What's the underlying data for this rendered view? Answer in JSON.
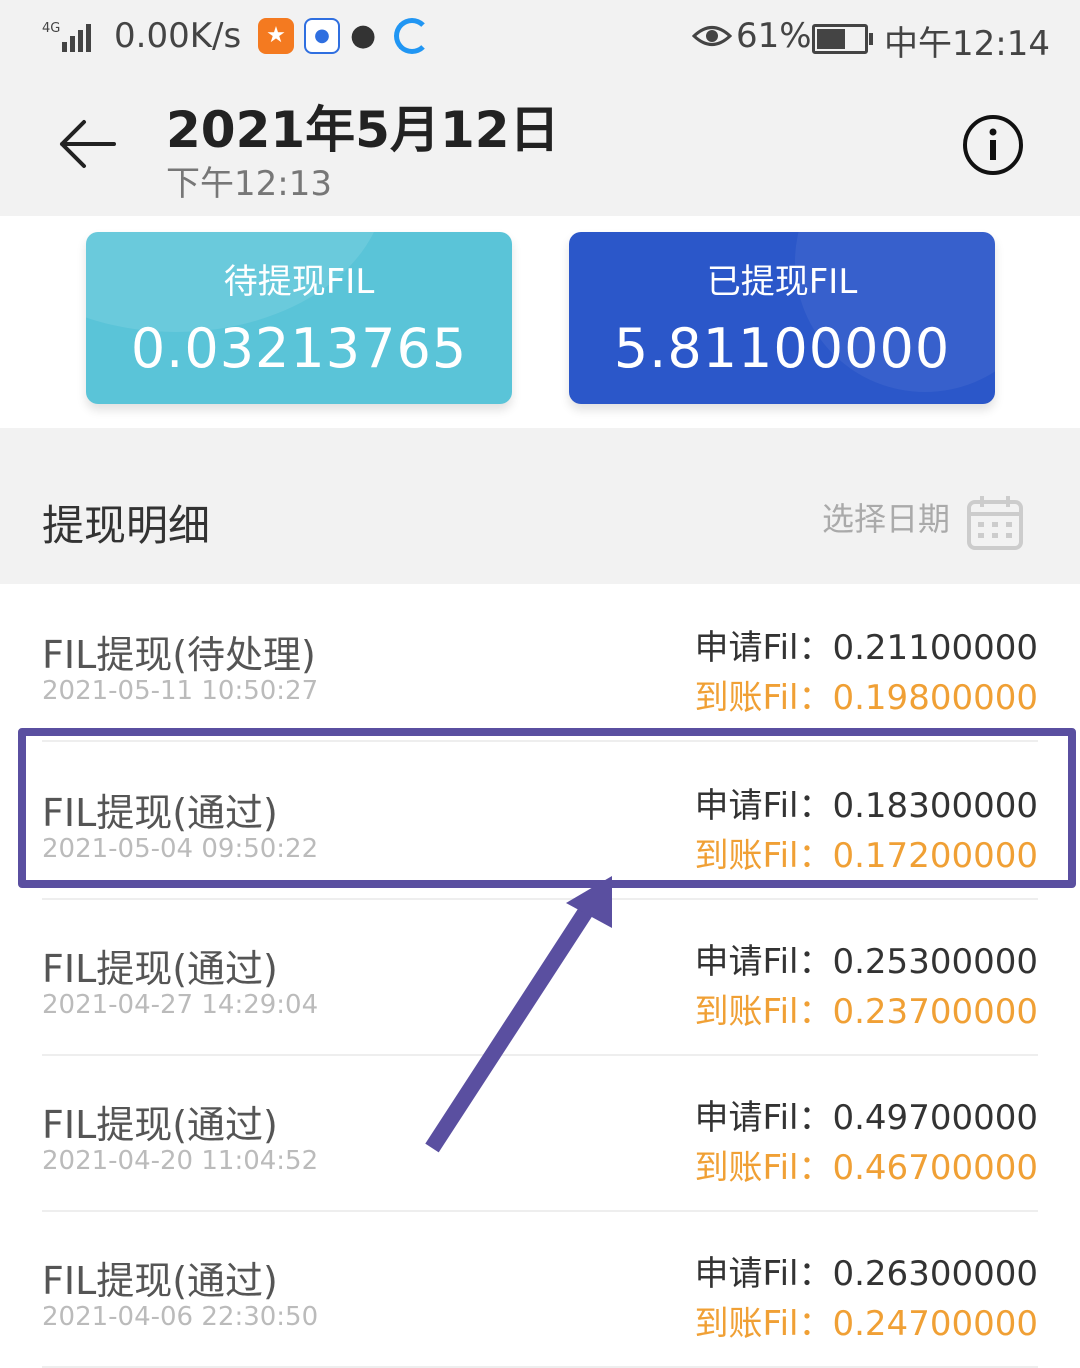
{
  "status_bar": {
    "signal": "4G",
    "net_speed": "0.00K/s",
    "battery": "61%",
    "battery_level": 0.61,
    "time": "中午12:14"
  },
  "header": {
    "title": "2021年5月12日",
    "subtitle": "下午12:13"
  },
  "cards": [
    {
      "label": "待提现FIL",
      "value": "0.03213765",
      "color": "#5ac4d8"
    },
    {
      "label": "已提现FIL",
      "value": "5.81100000",
      "color": "#2b57c9"
    }
  ],
  "section": {
    "title": "提现明细",
    "date_picker": "选择日期"
  },
  "records": [
    {
      "title": "FIL提现(待处理)",
      "time": "2021-05-11 10:50:27",
      "apply": "申请Fil：0.21100000",
      "received": "到账Fil：0.19800000"
    },
    {
      "title": "FIL提现(通过)",
      "time": "2021-05-04 09:50:22",
      "apply": "申请Fil：0.18300000",
      "received": "到账Fil：0.17200000"
    },
    {
      "title": "FIL提现(通过)",
      "time": "2021-04-27 14:29:04",
      "apply": "申请Fil：0.25300000",
      "received": "到账Fil：0.23700000"
    },
    {
      "title": "FIL提现(通过)",
      "time": "2021-04-20 11:04:52",
      "apply": "申请Fil：0.49700000",
      "received": "到账Fil：0.46700000"
    },
    {
      "title": "FIL提现(通过)",
      "time": "2021-04-06 22:30:50",
      "apply": "申请Fil：0.26300000",
      "received": "到账Fil：0.24700000"
    }
  ],
  "colors": {
    "accent_orange": "#f0a035",
    "annotation_purple": "#5a4fa0"
  }
}
